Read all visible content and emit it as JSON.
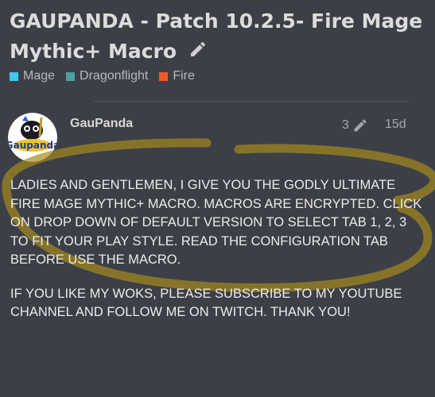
{
  "topic": {
    "title": "GAUPANDA - Patch 10.2.5- Fire Mage Mythic+ Macro",
    "categories": [
      {
        "label": "Mage",
        "color": "#3fc7eb"
      },
      {
        "label": "Dragonflight",
        "color": "#4aa2a2"
      },
      {
        "label": "Fire",
        "color": "#f05a2a"
      }
    ]
  },
  "post": {
    "author": "GauPanda",
    "avatar_text": "Gaupanda",
    "edit_count": "3",
    "age": "15d",
    "paragraphs": [
      "LADIES AND GENTLEMEN, I GIVE YOU THE GODLY ULTIMATE FIRE MAGE MYTHIC+ MACRO. MACROS ARE ENCRYPTED. CLICK ON DROP DOWN OF DEFAULT VERSION TO SELECT TAB 1, 2, 3 TO FIT YOUR PLAY STYLE. READ THE CONFIGURATION TAB BEFORE USE THE MACRO.",
      "IF YOU LIKE MY WOKS, PLEASE SUBSCRIBE TO MY YOUTUBE CHANNEL AND FOLLOW ME ON TWITCH. THANK YOU!"
    ]
  },
  "colors": {
    "background": "#3d3f47",
    "highlight": "#a48a1c"
  }
}
